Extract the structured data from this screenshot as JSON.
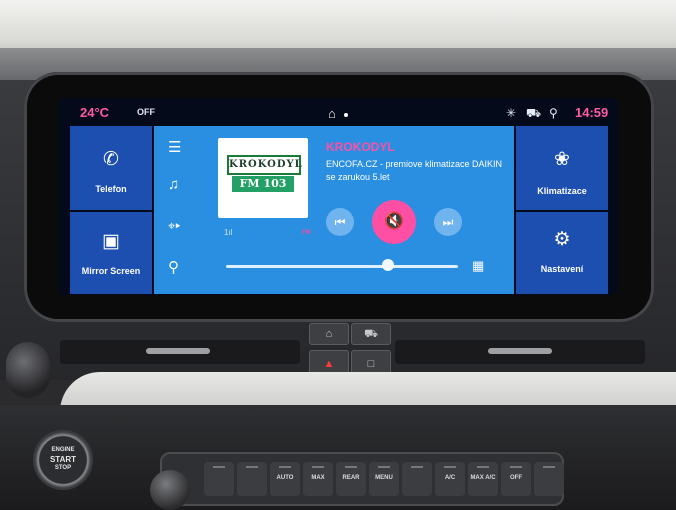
{
  "status_bar": {
    "temperature": "24°C",
    "climate_state": "OFF",
    "home_icon": "home-icon",
    "icons": [
      "bluetooth-icon",
      "car-icon",
      "location-icon"
    ],
    "time": "14:59"
  },
  "left_tiles": [
    {
      "label": "Telefon",
      "icon": "phone-icon"
    },
    {
      "label": "Mirror Screen",
      "icon": "mirror-screen-icon"
    }
  ],
  "right_tiles": [
    {
      "label": "Klimatizace",
      "icon": "fan-icon"
    },
    {
      "label": "Nastavení",
      "icon": "gear-icon"
    }
  ],
  "media": {
    "side_icons": [
      "menu-icon",
      "music-source-icon",
      "radio-antenna-icon",
      "search-icon"
    ],
    "album_art": {
      "brand": "KROKODYL",
      "frequency": "FM 103"
    },
    "signal_label": "1ıl",
    "band": "FM",
    "station": "KROKODYL",
    "radio_text": "ENCOFA.CZ - premiove klimatizace DAIKIN se zarukou 5.let",
    "controls": [
      "previous-icon",
      "mute-icon",
      "next-icon"
    ],
    "progress": 0.7,
    "library_icon": "library-icon"
  },
  "dash_buttons": {
    "row1": [
      "home-icon",
      "car-icon"
    ],
    "row2": [
      "hazard-icon",
      "lock-icon"
    ]
  },
  "engine_button": {
    "line1": "ENGINE",
    "line2": "START",
    "line3": "STOP"
  },
  "climate_panel": [
    "",
    "",
    "AUTO",
    "MAX",
    "REAR",
    "MENU",
    "",
    "A/C",
    "MAX A/C",
    "OFF",
    ""
  ],
  "accent_color": "#ff4fa5",
  "tile_color": "#1c4fb0",
  "media_color": "#2a8fe0"
}
